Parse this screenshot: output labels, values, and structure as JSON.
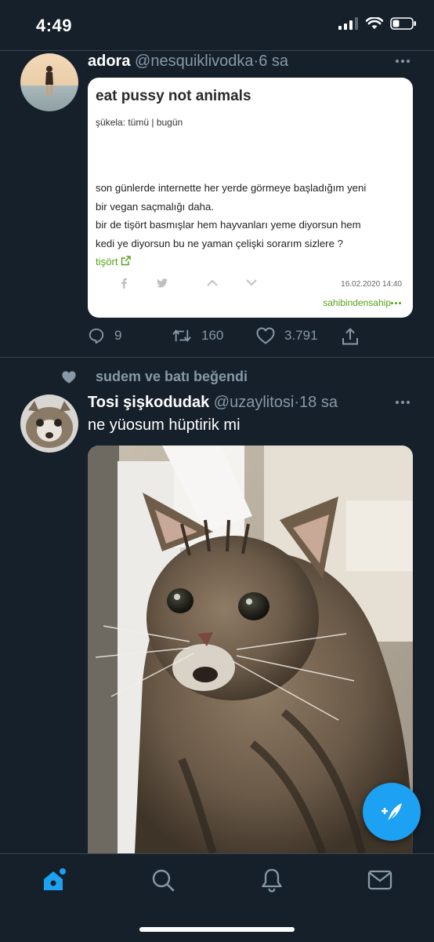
{
  "status_bar": {
    "time": "4:49"
  },
  "tweets": [
    {
      "name": "adora",
      "handle": "@nesquiklivodka",
      "separator": "·",
      "time": "6 sa",
      "card": {
        "title": "eat pussy not animals",
        "filter": "şükela:  tümü | bugün",
        "body_lines": [
          "son günlerde internette her yerde görmeye başladığım yeni",
          "bir vegan saçmalığı daha.",
          "bir de tişört basmışlar hem hayvanları yeme diyorsun hem",
          "kedi ye diyorsun bu ne yaman çelişki sorarım sizlere ?"
        ],
        "link": "tişört",
        "date": "16.02.2020 14:40",
        "author": "sahibindensahip"
      },
      "replies": "9",
      "retweets": "160",
      "likes": "3.791"
    },
    {
      "liked_by": "sudem ve batı beğendi",
      "name": "Tosi şişkodudak",
      "handle": "@uzaylitosi",
      "separator": "·",
      "time": "18 sa",
      "text": "ne yüosum hüptirik mi"
    }
  ],
  "tab_bar": [
    "home-icon",
    "search-icon",
    "notifications-icon",
    "messages-icon"
  ],
  "colors": {
    "background": "#15202b",
    "accent": "#1da1f2",
    "muted": "#8899a6",
    "card_link": "#53a318"
  }
}
